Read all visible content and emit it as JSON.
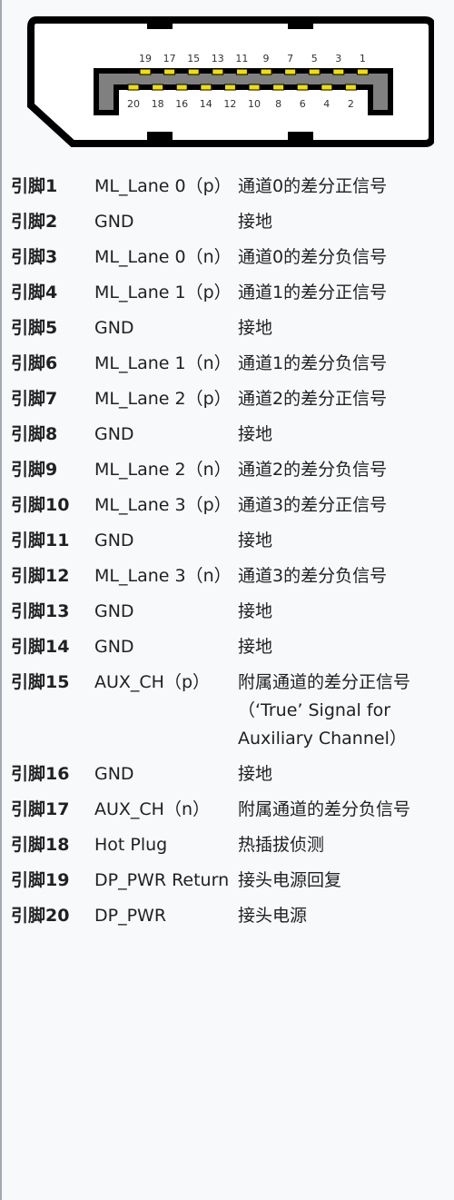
{
  "diagram": {
    "top_pins": [
      "19",
      "17",
      "15",
      "13",
      "11",
      "9",
      "7",
      "5",
      "3",
      "1"
    ],
    "bottom_pins": [
      "20",
      "18",
      "16",
      "14",
      "12",
      "10",
      "8",
      "6",
      "4",
      "2"
    ],
    "colors": {
      "outline": "#000000",
      "contact": "#f2e000",
      "insulator": "#808080",
      "body": "#ffffff"
    }
  },
  "rows": [
    {
      "pin": "引脚1",
      "signal": "ML_Lane 0（p）",
      "desc": "通道0的差分正信号"
    },
    {
      "pin": "引脚2",
      "signal": "GND",
      "desc": "接地"
    },
    {
      "pin": "引脚3",
      "signal": "ML_Lane 0（n）",
      "desc": "通道0的差分负信号"
    },
    {
      "pin": "引脚4",
      "signal": "ML_Lane 1（p）",
      "desc": "通道1的差分正信号"
    },
    {
      "pin": "引脚5",
      "signal": "GND",
      "desc": "接地"
    },
    {
      "pin": "引脚6",
      "signal": "ML_Lane 1（n）",
      "desc": "通道1的差分负信号"
    },
    {
      "pin": "引脚7",
      "signal": "ML_Lane 2（p）",
      "desc": "通道2的差分正信号"
    },
    {
      "pin": "引脚8",
      "signal": "GND",
      "desc": "接地"
    },
    {
      "pin": "引脚9",
      "signal": "ML_Lane 2（n）",
      "desc": "通道2的差分负信号"
    },
    {
      "pin": "引脚10",
      "signal": "ML_Lane 3（p）",
      "desc": "通道3的差分正信号"
    },
    {
      "pin": "引脚11",
      "signal": "GND",
      "desc": "接地"
    },
    {
      "pin": "引脚12",
      "signal": "ML_Lane 3（n）",
      "desc": "通道3的差分负信号"
    },
    {
      "pin": "引脚13",
      "signal": "GND",
      "desc": "接地"
    },
    {
      "pin": "引脚14",
      "signal": "GND",
      "desc": "接地"
    },
    {
      "pin": "引脚15",
      "signal": "AUX_CH（p）",
      "desc": "附属通道的差分正信号（‘True’ Signal for Auxiliary Channel）"
    },
    {
      "pin": "引脚16",
      "signal": "GND",
      "desc": "接地"
    },
    {
      "pin": "引脚17",
      "signal": "AUX_CH（n）",
      "desc": "附属通道的差分负信号"
    },
    {
      "pin": "引脚18",
      "signal": "Hot Plug",
      "desc": "热插拔侦测"
    },
    {
      "pin": "引脚19",
      "signal": "DP_PWR Return",
      "desc": "接头电源回复"
    },
    {
      "pin": "引脚20",
      "signal": "DP_PWR",
      "desc": "接头电源"
    }
  ]
}
